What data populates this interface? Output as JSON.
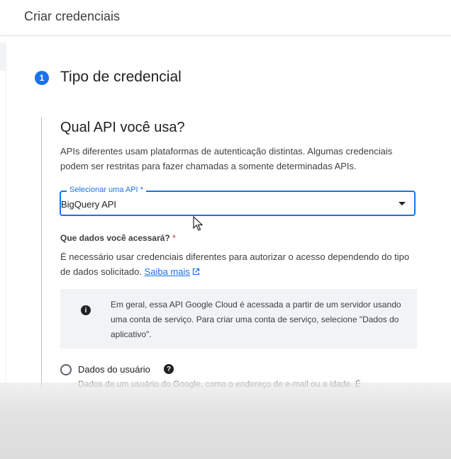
{
  "header": {
    "title": "Criar credenciais"
  },
  "step": {
    "number": "1",
    "title": "Tipo de credencial"
  },
  "section": {
    "heading": "Qual API você usa?",
    "description": "APIs diferentes usam plataformas de autenticação distintas. Algumas credenciais podem ser restritas para fazer chamadas a somente determinadas APIs."
  },
  "api_select": {
    "label": "Selecionar uma API",
    "required_mark": "*",
    "value": "BigQuery API"
  },
  "data_question": {
    "label": "Que dados você acessará?",
    "required_mark": "*",
    "description": "É necessário usar credenciais diferentes para autorizar o acesso dependendo do tipo de dados solicitado.",
    "learn_more": "Saiba mais"
  },
  "info": {
    "icon": "info-icon",
    "text": "Em geral, essa API Google Cloud é acessada a partir de um servidor usando uma conta de serviço. Para criar uma conta de serviço, selecione \"Dados do aplicativo\"."
  },
  "option_user_data": {
    "label": "Dados do usuário",
    "description": "Dados de um usuário do Google, como o endereço de e-mail ou a idade. É"
  },
  "colors": {
    "accent": "#1a73e8",
    "required": "#d93025"
  }
}
